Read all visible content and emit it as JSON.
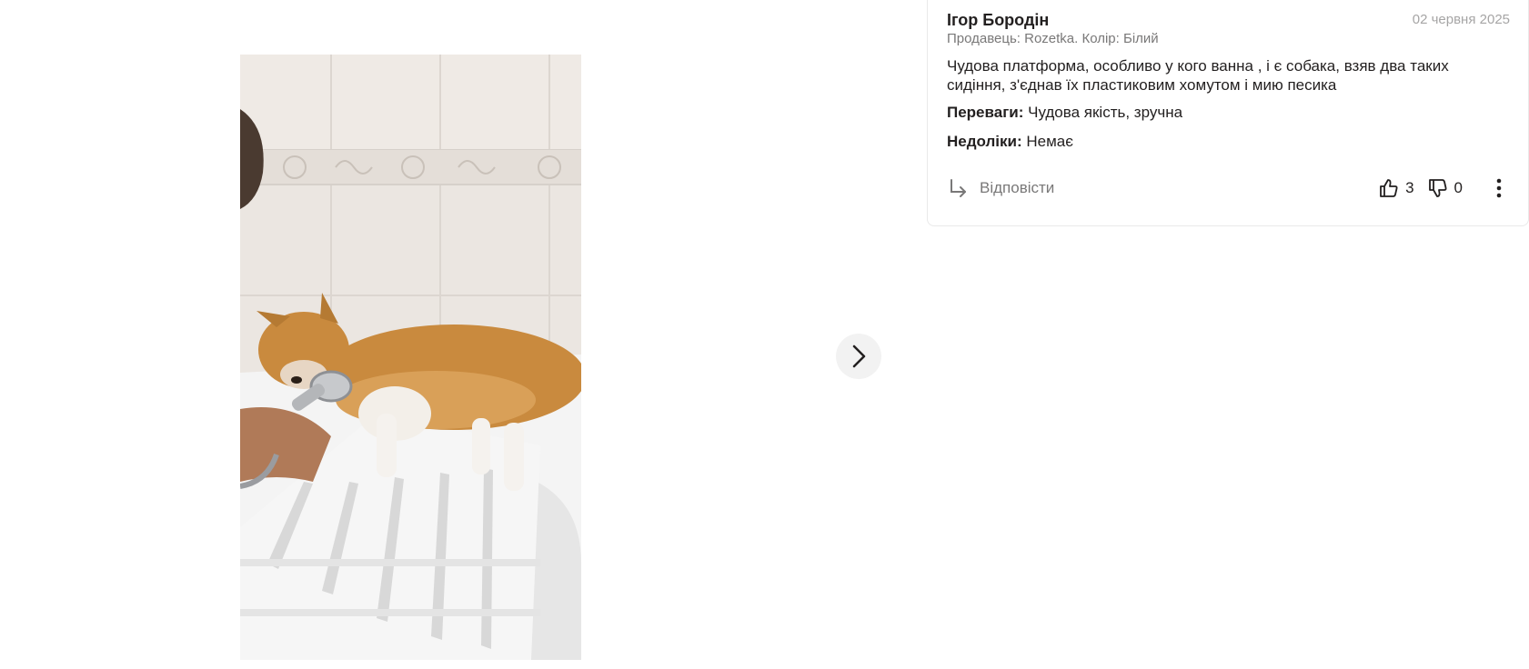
{
  "review": {
    "author": "Ігор Бородін",
    "date": "02 червня 2025",
    "meta": "Продавець: Rozetka. Колір: Білий",
    "text": "Чудова платформа, особливо у кого ванна , і є собака, взяв два таких сидіння, з'єднав їх пластиковим хомутом і мию песика",
    "pros_label": "Переваги:",
    "pros_value": "Чудова якість, зручна",
    "cons_label": "Недоліки:",
    "cons_value": "Немає",
    "reply_label": "Відповісти",
    "likes": "3",
    "dislikes": "0"
  },
  "icons": {
    "next": "chevron-right-icon",
    "reply": "reply-arrow-icon",
    "like": "thumb-up-icon",
    "dislike": "thumb-down-icon",
    "more": "more-vertical-icon"
  },
  "colors": {
    "text": "#221f1f",
    "muted": "#797878",
    "date": "#a6a5a5",
    "border": "#e9e9e9",
    "next_button_bg": "#f2f2f2"
  }
}
